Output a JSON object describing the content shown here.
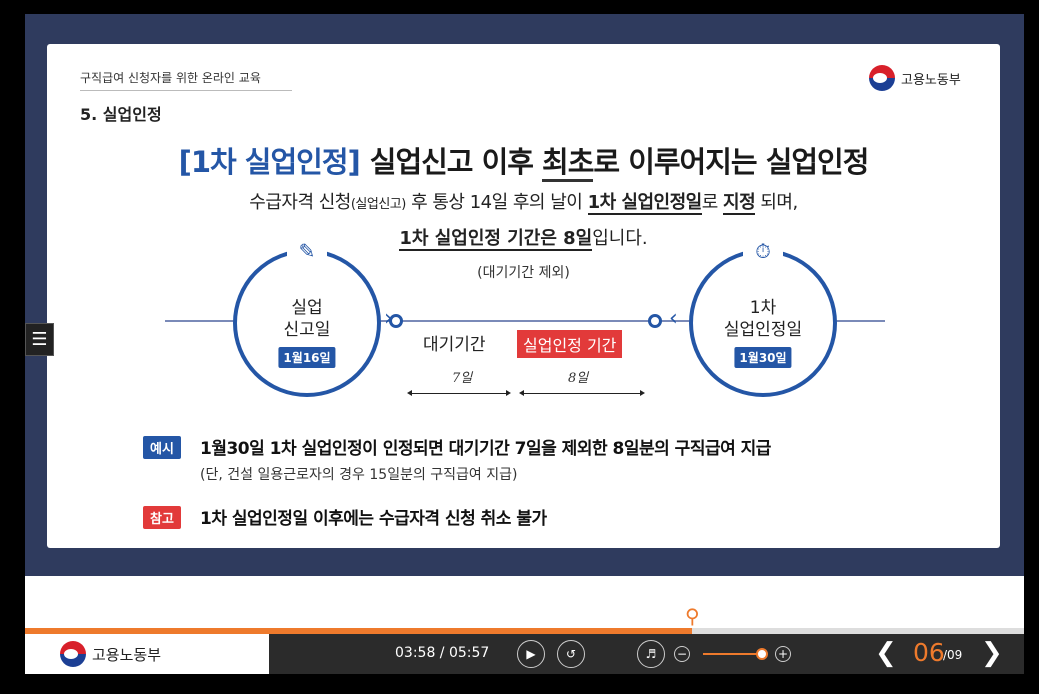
{
  "slide": {
    "course_title": "구직급여 신청자를 위한 온라인 교육",
    "section_title": "5. 실업인정",
    "logo_text": "고용노동부",
    "headline_tag": "[1차 실업인정]",
    "headline_a": "실업신고 이후 ",
    "headline_u": "최초",
    "headline_b": "로 이루어지는 실업인정",
    "desc1_a": "수급자격 신청",
    "desc1_small": "(실업신고)",
    "desc1_b": " 후 통상 14일 후의 날이 ",
    "desc1_u1": "1차 실업인정일",
    "desc1_c": "로 ",
    "desc1_u2": "지정",
    "desc1_d": " 되며,",
    "desc2_u": "1차 실업인정 기간은 8일",
    "desc2_b": "입니다.",
    "exclusion": "(대기기간 제외)",
    "left_ring": {
      "line1": "실업",
      "line2": "신고일",
      "date": "1월16일"
    },
    "right_ring": {
      "line1": "1차",
      "line2": "실업인정일",
      "date": "1월30일"
    },
    "wait_label": "대기기간",
    "period_label": "실업인정 기간",
    "wait_days": "7일",
    "period_days": "8일",
    "example_badge": "예시",
    "example_text": "1월30일 1차 실업인정이 인정되면 대기기간 7일을 제외한 8일분의 구직급여 지급",
    "example_sub": "(단, 건설 일용근로자의 경우 15일분의 구직급여 지급)",
    "note_badge": "참고",
    "note_text": "1차 실업인정일 이후에는 수급자격 신청 취소 불가",
    "colors": {
      "blue": "#2456a6",
      "red": "#e23a3a",
      "orange": "#ee7a2c",
      "navy": "#2f3b5e"
    }
  },
  "player": {
    "logo_text": "고용노동부",
    "time": "03:58 / 05:57",
    "progress": 0.668,
    "volume": 0.85,
    "page_current": "06",
    "page_total": "/09",
    "icons": [
      "menu-icon",
      "play-icon",
      "replay-icon",
      "volume-icon",
      "minus-icon",
      "plus-icon",
      "prev-icon",
      "next-icon"
    ]
  }
}
